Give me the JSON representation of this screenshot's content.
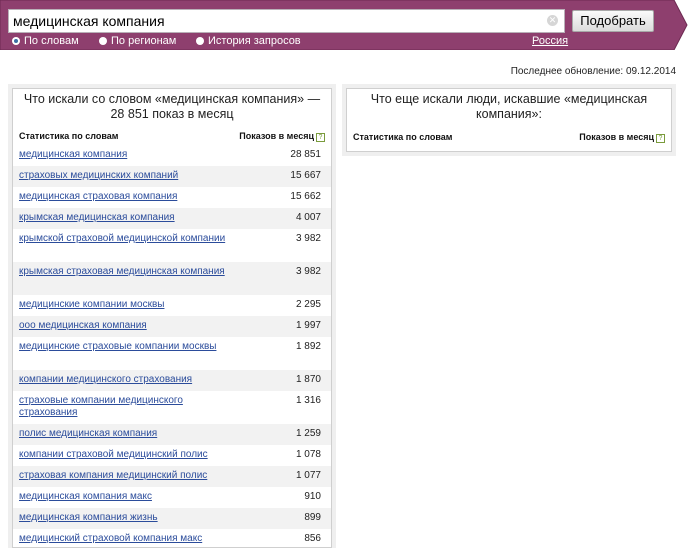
{
  "search": {
    "query": "медицинская компания",
    "submit_label": "Подобрать"
  },
  "modes": [
    {
      "label": "По словам",
      "selected": true
    },
    {
      "label": "По регионам",
      "selected": false
    },
    {
      "label": "История запросов",
      "selected": false
    }
  ],
  "region": "Россия",
  "updated": "Последнее обновление: 09.12.2014",
  "left_panel": {
    "title": "Что искали со словом «медицинская компания» — 28 851 показ в месяц",
    "col_keyword": "Статистика по словам",
    "col_count": "Показов в месяц",
    "help": "?",
    "rows": [
      {
        "keyword": "медицинская компания",
        "count": "28 851"
      },
      {
        "keyword": "страховых медицинских компаний",
        "count": "15 667"
      },
      {
        "keyword": "медицинская страховая компания",
        "count": "15 662"
      },
      {
        "keyword": "крымская медицинская компания",
        "count": "4 007"
      },
      {
        "keyword": "крымской страховой медицинской компании",
        "count": "3 982"
      },
      {
        "keyword": "крымская страховая медицинская компания",
        "count": "3 982"
      },
      {
        "keyword": "медицинские компании москвы",
        "count": "2 295"
      },
      {
        "keyword": "ооо медицинская компания",
        "count": "1 997"
      },
      {
        "keyword": "медицинские страховые компании москвы",
        "count": "1 892"
      },
      {
        "keyword": "компании медицинского страхования",
        "count": "1 870"
      },
      {
        "keyword": "страховые компании медицинского страхования",
        "count": "1 316"
      },
      {
        "keyword": "полис медицинская компания",
        "count": "1 259"
      },
      {
        "keyword": "компании страховой медицинский полис",
        "count": "1 078"
      },
      {
        "keyword": "страховая компания медицинский полис",
        "count": "1 077"
      },
      {
        "keyword": "медицинская компания макс",
        "count": "910"
      },
      {
        "keyword": "медицинская компания жизнь",
        "count": "899"
      },
      {
        "keyword": "медицинский страховой компания макс",
        "count": "856"
      }
    ]
  },
  "right_panel": {
    "title": "Что еще искали люди, искавшие «медицинская компания»:",
    "col_keyword": "Статистика по словам",
    "col_count": "Показов в месяц",
    "help": "?"
  }
}
